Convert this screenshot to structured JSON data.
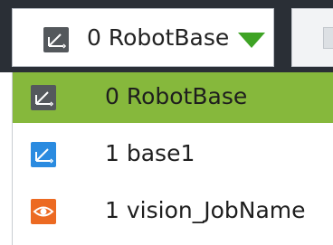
{
  "combo": {
    "selected_value": "0 RobotBase",
    "icon": "robot-base-coordinate-icon"
  },
  "dropdown": {
    "items": [
      {
        "label": "0 RobotBase",
        "icon": "robot-base-coordinate-icon",
        "selected": true
      },
      {
        "label": "1 base1",
        "icon": "base-coordinate-icon",
        "selected": false
      },
      {
        "label": "1 vision_JobName",
        "icon": "vision-eye-icon",
        "selected": false
      }
    ]
  },
  "colors": {
    "toolbar": "#2a2f36",
    "selected_item": "#86b83c",
    "dropdown_arrow": "#3ea324",
    "robot_base_icon": "#54585c",
    "base_icon": "#2a8be0",
    "vision_icon": "#ec6a22"
  }
}
